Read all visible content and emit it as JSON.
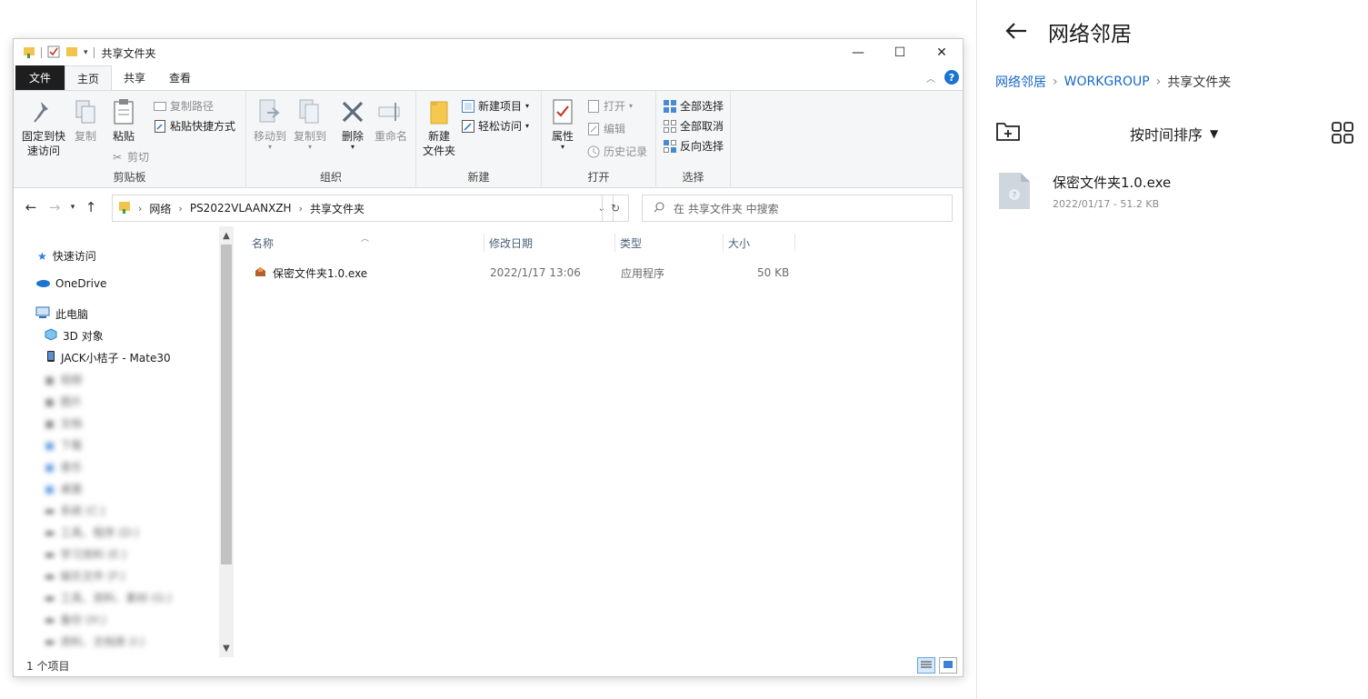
{
  "explorer": {
    "title": "共享文件夹",
    "window_buttons": {
      "minimize": "—",
      "maximize": "☐",
      "close": "✕"
    },
    "tabs": [
      "文件",
      "主页",
      "共享",
      "查看"
    ],
    "ribbon": {
      "clipboard": {
        "pin": "固定到快速访问",
        "pin_line1": "固定到快",
        "pin_line2": "速访问",
        "copy": "复制",
        "paste": "粘贴",
        "copy_path": "复制路径",
        "paste_shortcut": "粘贴快捷方式",
        "cut": "剪切",
        "label": "剪贴板"
      },
      "organize": {
        "move_to": "移动到",
        "copy_to": "复制到",
        "delete": "删除",
        "rename": "重命名",
        "label": "组织"
      },
      "new": {
        "new_folder_line1": "新建",
        "new_folder_line2": "文件夹",
        "new_item": "新建项目",
        "easy_access": "轻松访问",
        "label": "新建"
      },
      "open": {
        "properties": "属性",
        "open": "打开",
        "edit": "编辑",
        "history": "历史记录",
        "label": "打开"
      },
      "select": {
        "select_all": "全部选择",
        "select_none": "全部取消",
        "invert": "反向选择",
        "label": "选择"
      }
    },
    "address": {
      "crumbs": [
        "网络",
        "PS2022VLAANXZH",
        "共享文件夹"
      ]
    },
    "search_placeholder": "在 共享文件夹 中搜索",
    "nav": {
      "quick_access": "快速访问",
      "onedrive": "OneDrive",
      "this_pc": "此电脑",
      "objects3d": "3D 对象",
      "phone": "JACK小桔子 - Mate30",
      "blurred": [
        "视频",
        "图片",
        "文档",
        "下载",
        "音乐",
        "桌面",
        "系统 (C:)",
        "工具、程序 (D:)",
        "学习资料 (E:)",
        "娱乐文件 (F:)",
        "工具、资料、素材 (G:)",
        "备份 (H:)",
        "资料、文档库 (I:)"
      ]
    },
    "columns": [
      "名称",
      "修改日期",
      "类型",
      "大小"
    ],
    "files": [
      {
        "name": "保密文件夹1.0.exe",
        "modified": "2022/1/17 13:06",
        "type": "应用程序",
        "size": "50 KB"
      }
    ],
    "status": "1 个项目"
  },
  "panel": {
    "title": "网络邻居",
    "breadcrumb": [
      "网络邻居",
      "WORKGROUP",
      "共享文件夹"
    ],
    "sort_label": "按时间排序",
    "files": [
      {
        "name": "保密文件夹1.0.exe",
        "meta": "2022/01/17 - 51.2 KB"
      }
    ]
  },
  "colors": {
    "accent": "#1768c8",
    "file_tab": "#1e1e1e",
    "ribbon_bg": "#f5f6f7"
  }
}
